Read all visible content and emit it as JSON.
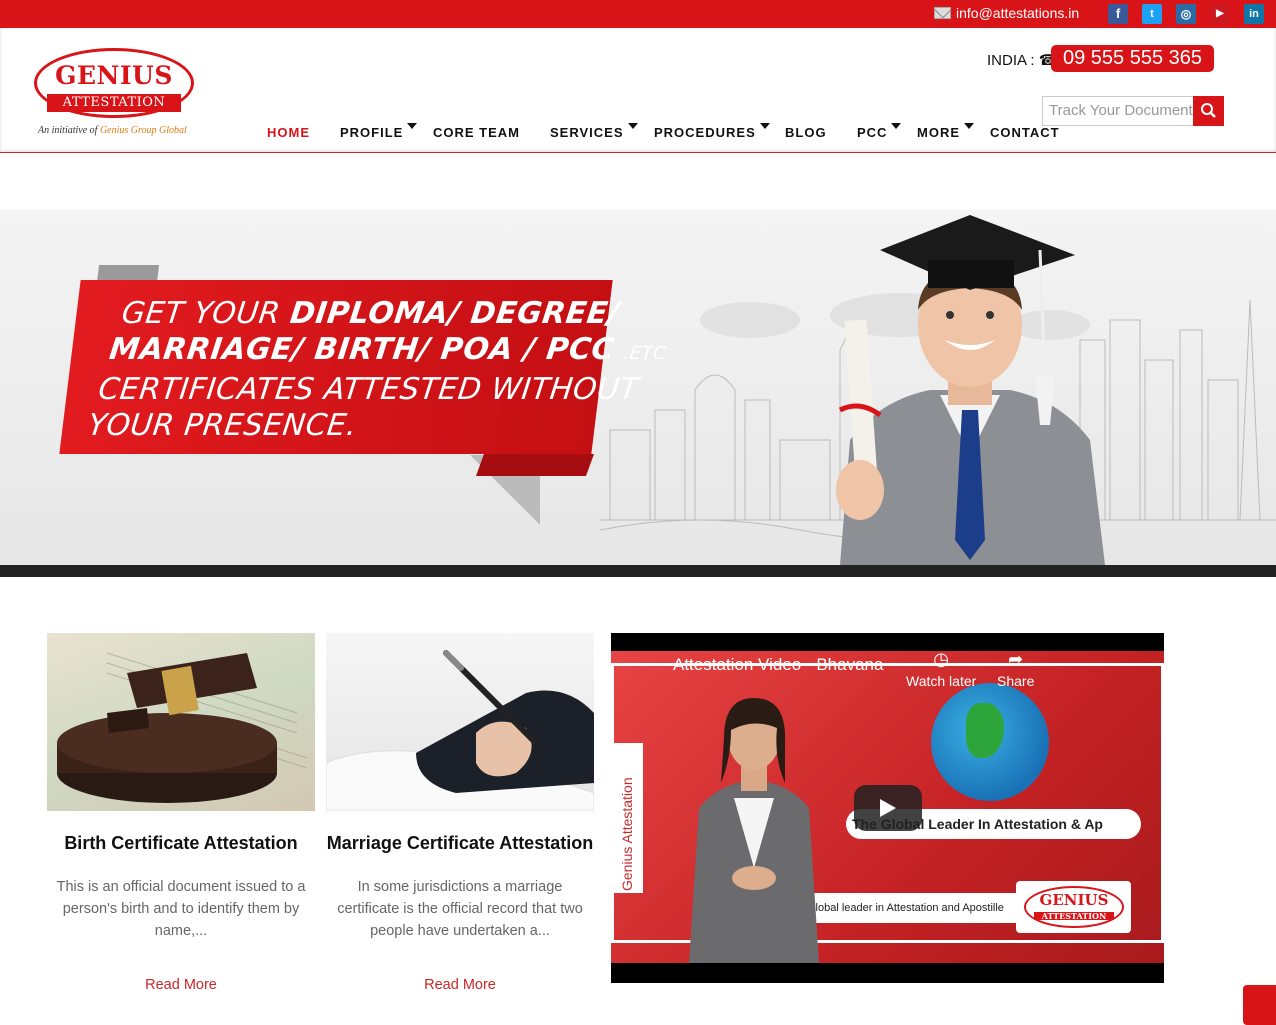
{
  "topbar": {
    "email": "info@attestations.in",
    "social": [
      {
        "name": "facebook",
        "glyph": "f",
        "color": "#3b5998"
      },
      {
        "name": "twitter",
        "glyph": "t",
        "color": "#1da1f2"
      },
      {
        "name": "instagram",
        "glyph": "◎",
        "color": "#2a6aa5"
      },
      {
        "name": "youtube",
        "glyph": "▶",
        "color": "#cc181e"
      },
      {
        "name": "linkedin",
        "glyph": "in",
        "color": "#0e76a8"
      }
    ]
  },
  "header": {
    "logo_line1": "GENIUS",
    "logo_line2": "ATTESTATION",
    "tagline_prefix": "An initiative of",
    "tagline_brand": "Genius Group Global",
    "phone_label": "INDIA :",
    "phone_number": "09 555 555 365",
    "track_placeholder": "Track Your Document"
  },
  "nav": {
    "items": [
      {
        "label": "HOME"
      },
      {
        "label": "PROFILE"
      },
      {
        "label": "CORE TEAM"
      },
      {
        "label": "SERVICES"
      },
      {
        "label": "PROCEDURES"
      },
      {
        "label": "BLOG"
      },
      {
        "label": "PCC"
      },
      {
        "label": "MORE"
      },
      {
        "label": "CONTACT"
      }
    ]
  },
  "banner": {
    "line1_a": "GET YOUR",
    "line1_b": "DIPLOMA/ DEGREE/",
    "line2": "MARRIAGE/ BIRTH/ POA / PCC",
    "line2_etc": ".ETC",
    "line3": "CERTIFICATES ATTESTED WITHOUT",
    "line4": "YOUR PRESENCE."
  },
  "cards": [
    {
      "title": "Birth Certificate Attestation",
      "excerpt": "This is an official document issued to a person's birth and to identify them by name,...",
      "link": "Read More"
    },
    {
      "title": "Marriage Certificate Attestation",
      "excerpt": "In some jurisdictions a marriage certificate is the official record that two people have undertaken a...",
      "link": "Read More"
    }
  ],
  "video": {
    "title": "Attestation Video - Bhavana",
    "watch_later": "Watch later",
    "share": "Share",
    "side_text": "Genius Attestation",
    "slide_heading": "The Global Leader In Attestation & Ap",
    "slide_sub": "Global leader in Attestation and Apostille",
    "mini_logo_1": "GENIUS",
    "mini_logo_2": "ATTESTATION"
  }
}
